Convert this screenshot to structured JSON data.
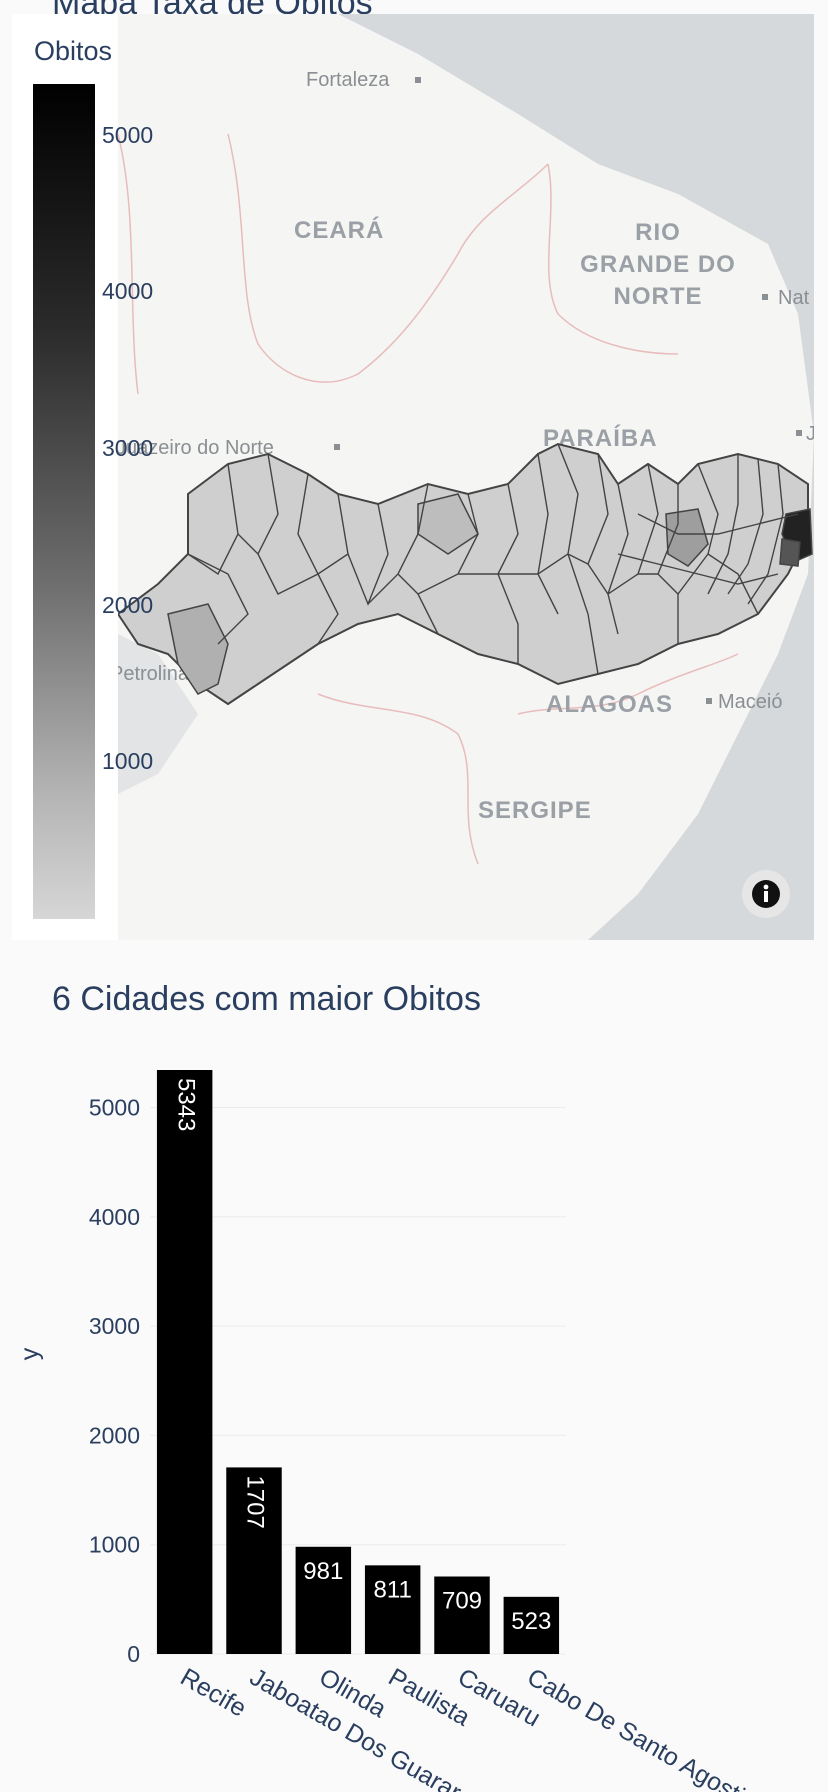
{
  "map": {
    "title": "Mapa Taxa de Obitos",
    "colorbar_title": "Obitos",
    "colorbar_ticks": [
      "5000",
      "4000",
      "3000",
      "2000",
      "1000"
    ],
    "state_labels": [
      "CEARÁ",
      "RIO",
      "GRANDE DO",
      "NORTE",
      "PARAÍBA",
      "ALAGOAS",
      "SERGIPE"
    ],
    "city_labels": [
      "Fortaleza",
      "Juazeiro do Norte",
      "Maceió",
      "Petrolina",
      "Nat",
      "J"
    ],
    "colors": {
      "sea": "#d6d9db",
      "land": "#f5f5f3",
      "region_fill": "#cfcfcf",
      "region_stroke": "#444444"
    }
  },
  "bar_chart_title": "6 Cidades com maior Obitos",
  "chart_data": {
    "type": "bar",
    "title": "6 Cidades com maior Obitos",
    "categories": [
      "Recife",
      "Jaboatao Dos Guararapes",
      "Olinda",
      "Paulista",
      "Caruaru",
      "Cabo De Santo Agostinho"
    ],
    "values": [
      5343,
      1707,
      981,
      811,
      709,
      523
    ],
    "ylabel": "y",
    "xlabel": "",
    "ylim": [
      0,
      5343
    ],
    "yticks": [
      0,
      1000,
      2000,
      3000,
      4000,
      5000
    ],
    "bar_color": "#000000",
    "grid": true
  }
}
